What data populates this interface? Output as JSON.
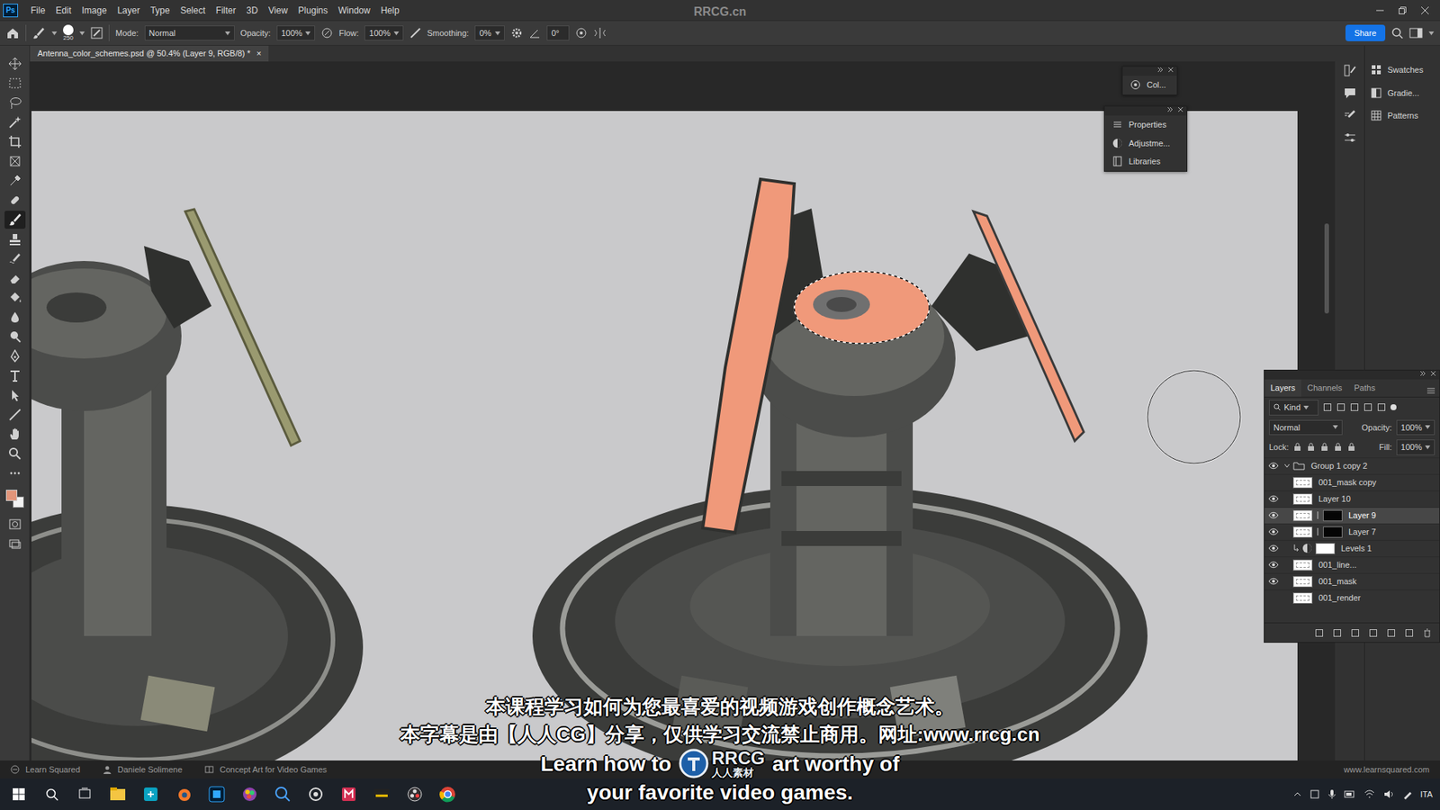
{
  "app": {
    "logo": "Ps",
    "watermark": "RRCG.cn"
  },
  "menu": [
    "File",
    "Edit",
    "Image",
    "Layer",
    "Type",
    "Select",
    "Filter",
    "3D",
    "View",
    "Plugins",
    "Window",
    "Help"
  ],
  "options": {
    "brush_size": "250",
    "mode_label": "Mode:",
    "mode": "Normal",
    "opacity_label": "Opacity:",
    "opacity": "100%",
    "flow_label": "Flow:",
    "flow": "100%",
    "smoothing_label": "Smoothing:",
    "smoothing": "0%",
    "angle": "0°",
    "share": "Share"
  },
  "document_tab": {
    "title": "Antenna_color_schemes.psd @ 50.4% (Layer 9, RGB/8) *",
    "close": "×"
  },
  "tools": [
    {
      "kind": "move",
      "selected": false
    },
    {
      "kind": "marquee",
      "selected": false
    },
    {
      "kind": "lasso",
      "selected": false
    },
    {
      "kind": "wand",
      "selected": false
    },
    {
      "kind": "crop",
      "selected": false
    },
    {
      "kind": "frame",
      "selected": false
    },
    {
      "kind": "eyedropper",
      "selected": false
    },
    {
      "kind": "heal",
      "selected": false
    },
    {
      "kind": "brush",
      "selected": true
    },
    {
      "kind": "stamp",
      "selected": false
    },
    {
      "kind": "history",
      "selected": false
    },
    {
      "kind": "eraser",
      "selected": false
    },
    {
      "kind": "bucket",
      "selected": false
    },
    {
      "kind": "blur",
      "selected": false
    },
    {
      "kind": "dodge",
      "selected": false
    },
    {
      "kind": "pen",
      "selected": false
    },
    {
      "kind": "type",
      "selected": false
    },
    {
      "kind": "pathselect",
      "selected": false
    },
    {
      "kind": "line",
      "selected": false
    },
    {
      "kind": "hand",
      "selected": false
    },
    {
      "kind": "zoom",
      "selected": false
    },
    {
      "kind": "more",
      "selected": false
    }
  ],
  "colors": {
    "foreground": "#e3957a",
    "background": "#f2f2f2"
  },
  "floating_panels": [
    {
      "items": [
        {
          "label": "Col..."
        }
      ]
    },
    {
      "items": [
        {
          "label": "Properties"
        },
        {
          "label": "Adjustme..."
        },
        {
          "label": "Libraries"
        }
      ]
    }
  ],
  "dock": {
    "items": [
      {
        "label": "Swatches"
      },
      {
        "label": "Gradie..."
      },
      {
        "label": "Patterns"
      }
    ]
  },
  "layers_panel": {
    "tabs": [
      {
        "label": "Layers",
        "selected": true
      },
      {
        "label": "Channels",
        "selected": false
      },
      {
        "label": "Paths",
        "selected": false
      }
    ],
    "filter": "Kind",
    "blend": "Normal",
    "opacity_label": "Opacity:",
    "opacity": "100%",
    "lock_label": "Lock:",
    "fill_label": "Fill:",
    "fill": "100%",
    "layers": [
      {
        "name": "Group 1 copy 2",
        "kind": "group",
        "visible": true,
        "selected": false
      },
      {
        "name": "001_mask copy",
        "kind": "pixel",
        "visible": false,
        "selected": false
      },
      {
        "name": "Layer 10",
        "kind": "pixel",
        "visible": true,
        "selected": false
      },
      {
        "name": "Layer 9",
        "kind": "masked",
        "visible": true,
        "selected": true
      },
      {
        "name": "Layer 7",
        "kind": "masked",
        "visible": true,
        "selected": false
      },
      {
        "name": "Levels 1",
        "kind": "adjustment",
        "visible": true,
        "selected": false
      },
      {
        "name": "001_line...",
        "kind": "pixel",
        "visible": true,
        "selected": false
      },
      {
        "name": "001_mask",
        "kind": "pixel",
        "visible": true,
        "selected": false
      },
      {
        "name": "001_render",
        "kind": "pixel",
        "visible": false,
        "selected": false
      }
    ]
  },
  "subtitles": {
    "zh": [
      "本课程学习如何为您最喜爱的视频游戏创作概念艺术。",
      "本字幕是由【人人CG】分享，仅供学习交流禁止商用。网址:www.rrcg.cn"
    ],
    "en_line1_before": "Learn how to",
    "en_line1_after": "art worthy of",
    "en_line2": "your favorite video games.",
    "logo_mark": "RRCG",
    "logo_sub": "人人素材"
  },
  "status_bar": {
    "items": [
      "Learn Squared",
      "Daniele Solimene",
      "Concept Art for Video Games"
    ],
    "url": "www.learnsquared.com"
  },
  "taskbar": {
    "apps": [
      {
        "kind": "explorer"
      },
      {
        "kind": "store"
      },
      {
        "kind": "blender"
      },
      {
        "kind": "photoshop"
      },
      {
        "kind": "colors"
      },
      {
        "kind": "search"
      },
      {
        "kind": "capture"
      },
      {
        "kind": "notes"
      },
      {
        "kind": "terminal"
      },
      {
        "kind": "obs"
      },
      {
        "kind": "chrome"
      }
    ],
    "lang": "ITA"
  }
}
